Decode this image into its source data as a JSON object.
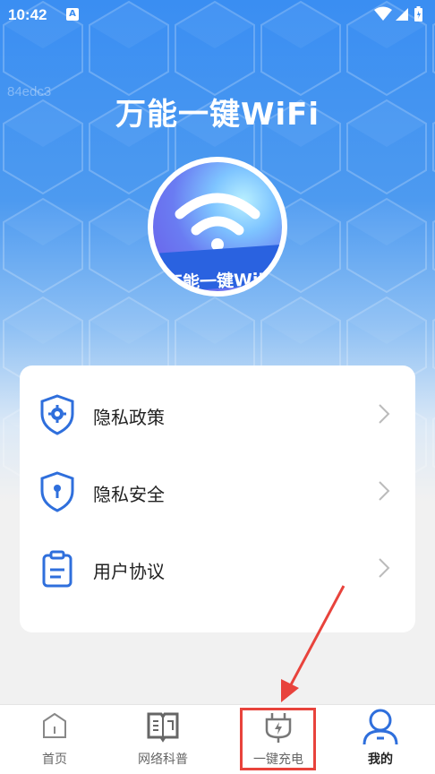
{
  "status_bar": {
    "time": "10:42",
    "notification_icon": "A"
  },
  "watermark": "84edc3",
  "app": {
    "title": "万能一键WiFi",
    "logo_text": "万能一键WiFi"
  },
  "menu": {
    "items": [
      {
        "label": "隐私政策",
        "icon": "shield-gear-icon"
      },
      {
        "label": "隐私安全",
        "icon": "shield-lock-icon"
      },
      {
        "label": "用户协议",
        "icon": "clipboard-icon"
      }
    ]
  },
  "tabbar": {
    "tabs": [
      {
        "label": "首页",
        "icon": "home-icon"
      },
      {
        "label": "网络科普",
        "icon": "book-icon"
      },
      {
        "label": "一键充电",
        "icon": "charger-plug-icon"
      },
      {
        "label": "我的",
        "icon": "user-icon",
        "active": true
      }
    ]
  },
  "colors": {
    "primary": "#3a8ef2",
    "icon_blue": "#2f6fdc",
    "highlight": "#e8433c"
  }
}
